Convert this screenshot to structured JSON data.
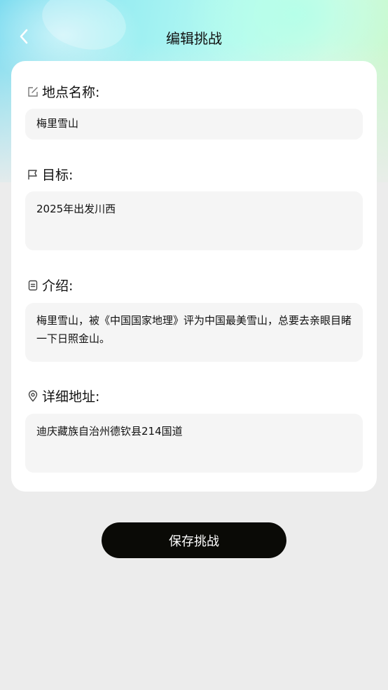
{
  "header": {
    "title": "编辑挑战"
  },
  "form": {
    "location": {
      "label": "地点名称:",
      "value": "梅里雪山"
    },
    "goal": {
      "label": "目标:",
      "value": "2025年出发川西"
    },
    "intro": {
      "label": "介绍:",
      "value": "梅里雪山，被《中国国家地理》评为中国最美雪山，总要去亲眼目睹一下日照金山。"
    },
    "address": {
      "label": "详细地址:",
      "value": "迪庆藏族自治州德钦县214国道"
    }
  },
  "actions": {
    "save_label": "保存挑战"
  },
  "icons": {
    "back": "chevron-left-icon",
    "location": "edit-icon",
    "goal": "flag-icon",
    "intro": "document-icon",
    "address": "map-pin-icon"
  }
}
